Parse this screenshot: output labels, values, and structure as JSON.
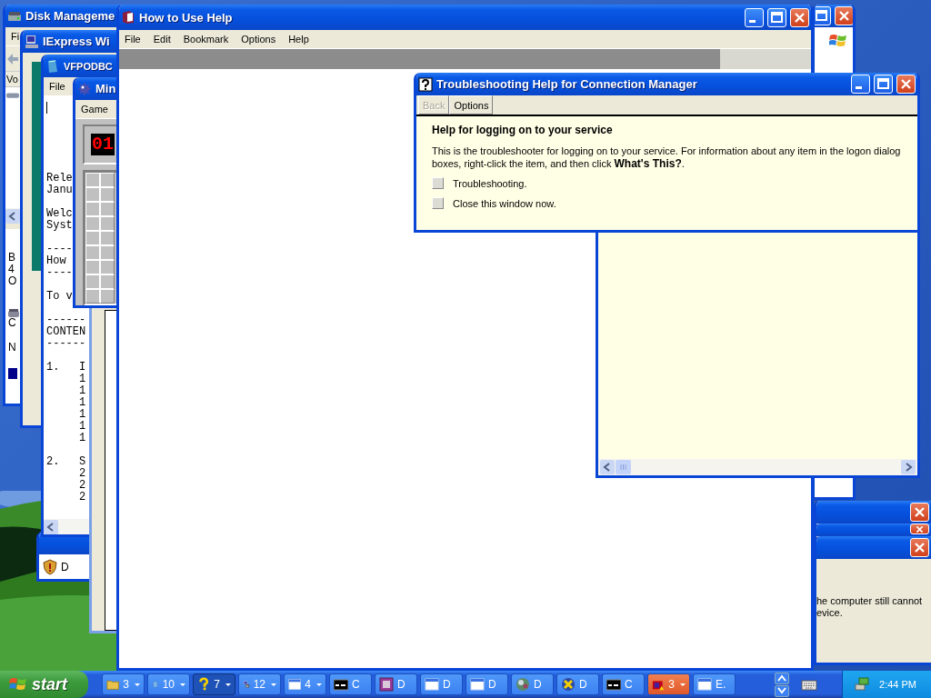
{
  "disk_management": {
    "title": "Disk Manageme",
    "menu": [
      "Fi"
    ],
    "column": "Vo",
    "labels": [
      "B",
      "4",
      "O"
    ],
    "disk_labels": [
      "C",
      "N"
    ]
  },
  "iexpress": {
    "title": "IExpress Wi"
  },
  "vfpodbc": {
    "title": "VFPODBC",
    "menu": [
      "File"
    ],
    "blocks": [
      [
        "Rele",
        "Janu"
      ],
      [
        "Welc",
        "Syst"
      ],
      [
        "----",
        "How",
        "----"
      ],
      [
        "To v"
      ],
      [
        "------",
        "CONTEN",
        "------"
      ],
      [
        "1.   I",
        "     1",
        "     1",
        "     1",
        "     1",
        "     1",
        "     1"
      ],
      [
        "2.   S",
        "     2",
        "     2",
        "     2"
      ]
    ]
  },
  "minesweeper": {
    "title": "Min",
    "menu": [
      "Game"
    ],
    "mine_counter": "01"
  },
  "security_window": {
    "text": "D"
  },
  "help": {
    "title": "How to Use Help",
    "menu": [
      "File",
      "Edit",
      "Bookmark",
      "Options",
      "Help"
    ]
  },
  "troubleshooter": {
    "title": "Troubleshooting Help for Connection Manager",
    "toolbar": [
      {
        "label": "Back",
        "disabled": true
      },
      {
        "label": "Options",
        "disabled": false
      }
    ],
    "heading": "Help for logging on to your service",
    "body": "This is the troubleshooter for logging on to your service. For information about any item in the logon dialog boxes, right-click the item, and then click **What's This?**.",
    "options": [
      "Troubleshooting.",
      "Close this window now."
    ]
  },
  "message_dialog": {
    "lines": [
      "he computer still cannot",
      "evice."
    ]
  },
  "taskbar": {
    "start_label": "start",
    "buttons": [
      {
        "kind": "folder",
        "label": "3",
        "grouped": true,
        "selected": false,
        "flashing": false
      },
      {
        "kind": "notepad",
        "label": "10",
        "grouped": true,
        "selected": false,
        "flashing": false
      },
      {
        "kind": "help",
        "label": "7",
        "grouped": true,
        "selected": true,
        "flashing": false
      },
      {
        "kind": "setup",
        "label": "12",
        "grouped": true,
        "selected": false,
        "flashing": false
      },
      {
        "kind": "window",
        "label": "4",
        "grouped": true,
        "selected": false,
        "flashing": false
      },
      {
        "kind": "console",
        "label": "C",
        "grouped": false,
        "selected": false,
        "flashing": false
      },
      {
        "kind": "paint",
        "label": "D",
        "grouped": false,
        "selected": false,
        "flashing": false
      },
      {
        "kind": "window",
        "label": "D",
        "grouped": false,
        "selected": false,
        "flashing": false
      },
      {
        "kind": "window",
        "label": "D",
        "grouped": false,
        "selected": false,
        "flashing": false
      },
      {
        "kind": "app",
        "label": "D",
        "grouped": false,
        "selected": false,
        "flashing": false
      },
      {
        "kind": "xcircle",
        "label": "D",
        "grouped": false,
        "selected": false,
        "flashing": false
      },
      {
        "kind": "console",
        "label": "C",
        "grouped": false,
        "selected": false,
        "flashing": false
      },
      {
        "kind": "alert",
        "label": "3",
        "grouped": true,
        "selected": false,
        "flashing": true
      },
      {
        "kind": "window",
        "label": "E.",
        "grouped": false,
        "selected": false,
        "flashing": false
      }
    ],
    "clock": "2:44 PM"
  }
}
